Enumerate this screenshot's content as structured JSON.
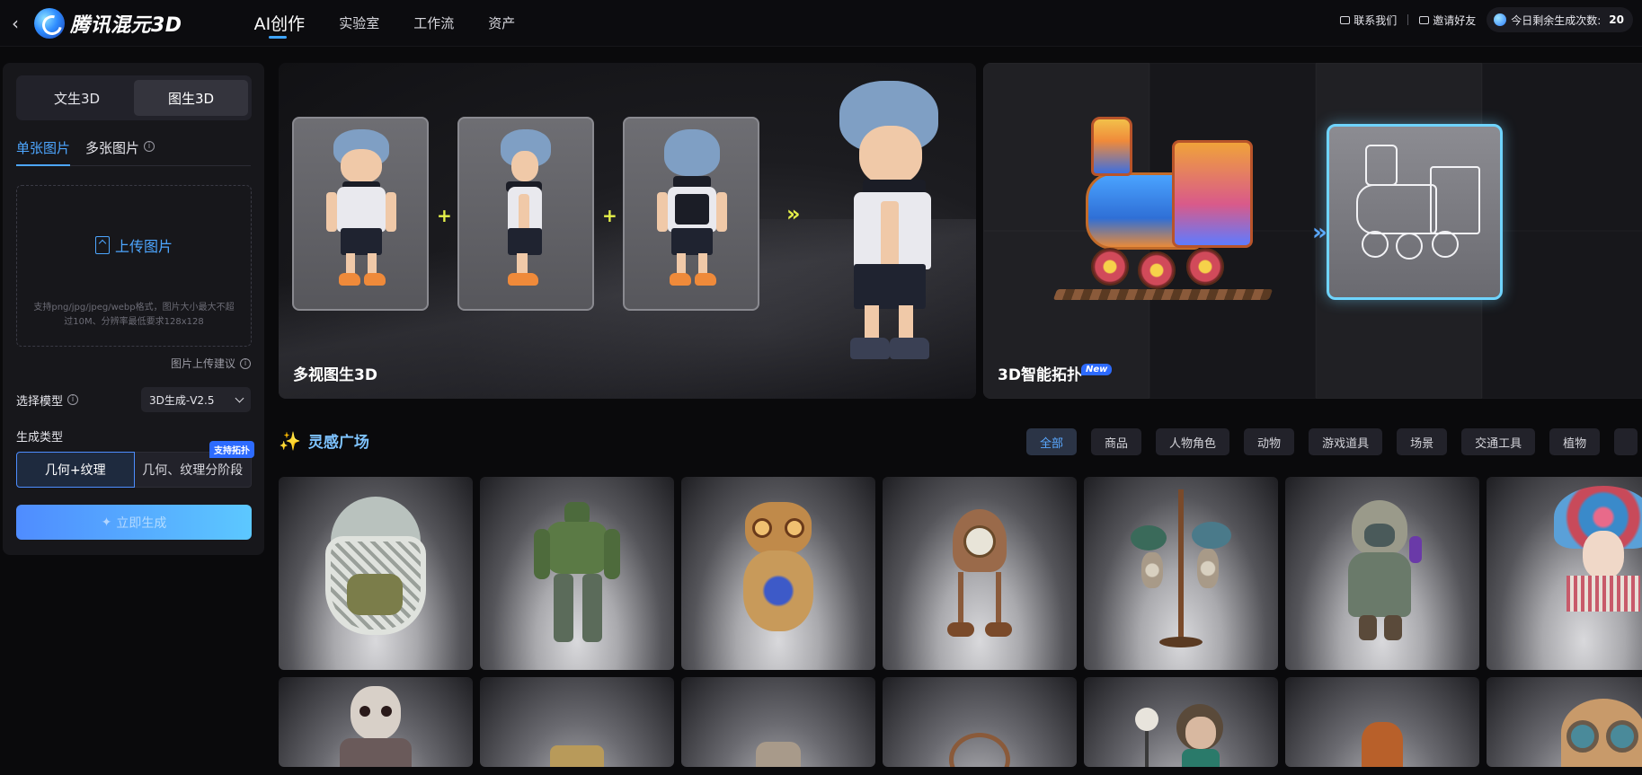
{
  "topbar": {
    "back_icon": "chevron-left-icon",
    "logo_text": "腾讯混元3D",
    "nav": [
      {
        "label": "AI创作",
        "active": true
      },
      {
        "label": "实验室",
        "active": false
      },
      {
        "label": "工作流",
        "active": false
      },
      {
        "label": "资产",
        "active": false
      }
    ],
    "contact_label": "联系我们",
    "invite_label": "邀请好友",
    "credits_label": "今日剩余生成次数:",
    "credits_value": "20"
  },
  "left_panel": {
    "mode_tabs": [
      {
        "label": "文生3D",
        "active": false
      },
      {
        "label": "图生3D",
        "active": true
      }
    ],
    "sub_tabs": [
      {
        "label": "单张图片",
        "active": true
      },
      {
        "label": "多张图片",
        "active": false
      }
    ],
    "upload_label": "上传图片",
    "upload_hint": "支持png/jpg/jpeg/webp格式，图片大小最大不超过10M、分辨率最低要求128x128",
    "upload_advice": "图片上传建议",
    "model_label": "选择模型",
    "model_value": "3D生成-V2.5",
    "gen_type_label": "生成类型",
    "gen_options": [
      {
        "label": "几何+纹理",
        "active": true
      },
      {
        "label": "几何、纹理分阶段",
        "active": false
      }
    ],
    "gen_badge": "支持拓扑",
    "generate_label": "立即生成"
  },
  "banners": [
    {
      "title": "多视图生3D"
    },
    {
      "title": "3D智能拓扑",
      "badge": "New"
    }
  ],
  "inspiration": {
    "title": "灵感广场",
    "filters": [
      "全部",
      "商品",
      "人物角色",
      "动物",
      "游戏道具",
      "场景",
      "交通工具",
      "植物"
    ],
    "active_filter": "全部"
  },
  "colors": {
    "accent": "#4da6ff",
    "badge": "#2d6bff",
    "highlight": "#e5f04a",
    "background": "#0a0a0c",
    "panel": "#17171b"
  }
}
